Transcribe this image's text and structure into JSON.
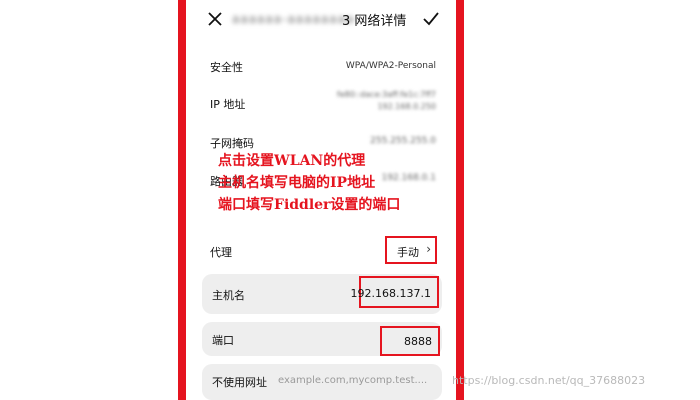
{
  "header": {
    "network_name_blurred": "aaaaaa-aaaaaaaa-",
    "title_suffix": "3 网络详情"
  },
  "details": {
    "security_label": "安全性",
    "security_value": "WPA/WPA2-Personal",
    "ip_label": "IP 地址",
    "ip_value_line1": "fe80::dace:3aff:fe1c:7ff7",
    "ip_value_line2": "192.168.0.250",
    "subnet_label": "子网掩码",
    "subnet_value": "255.255.255.0",
    "router_label": "路由器",
    "router_value": "192.168.0.1"
  },
  "proxy": {
    "label": "代理",
    "mode": "手动",
    "chevron": "›"
  },
  "fields": {
    "hostname_label": "主机名",
    "hostname_value": "192.168.137.1",
    "port_label": "端口",
    "port_value": "8888",
    "bypass_label": "不使用网址",
    "bypass_placeholder": "example.com,mycomp.test...."
  },
  "annotations": {
    "line1": "点击设置WLAN的代理",
    "line2": "主机名填写电脑的IP地址",
    "line3": "端口填写Fiddler设置的端口"
  },
  "watermark": "https://blog.csdn.net/qq_37688023",
  "colors": {
    "annotation_red": "#e5141f",
    "field_bg": "#eeeeee"
  },
  "icons": {
    "close": "close-icon",
    "confirm": "check-icon",
    "chevron": "chevron-right-icon"
  }
}
